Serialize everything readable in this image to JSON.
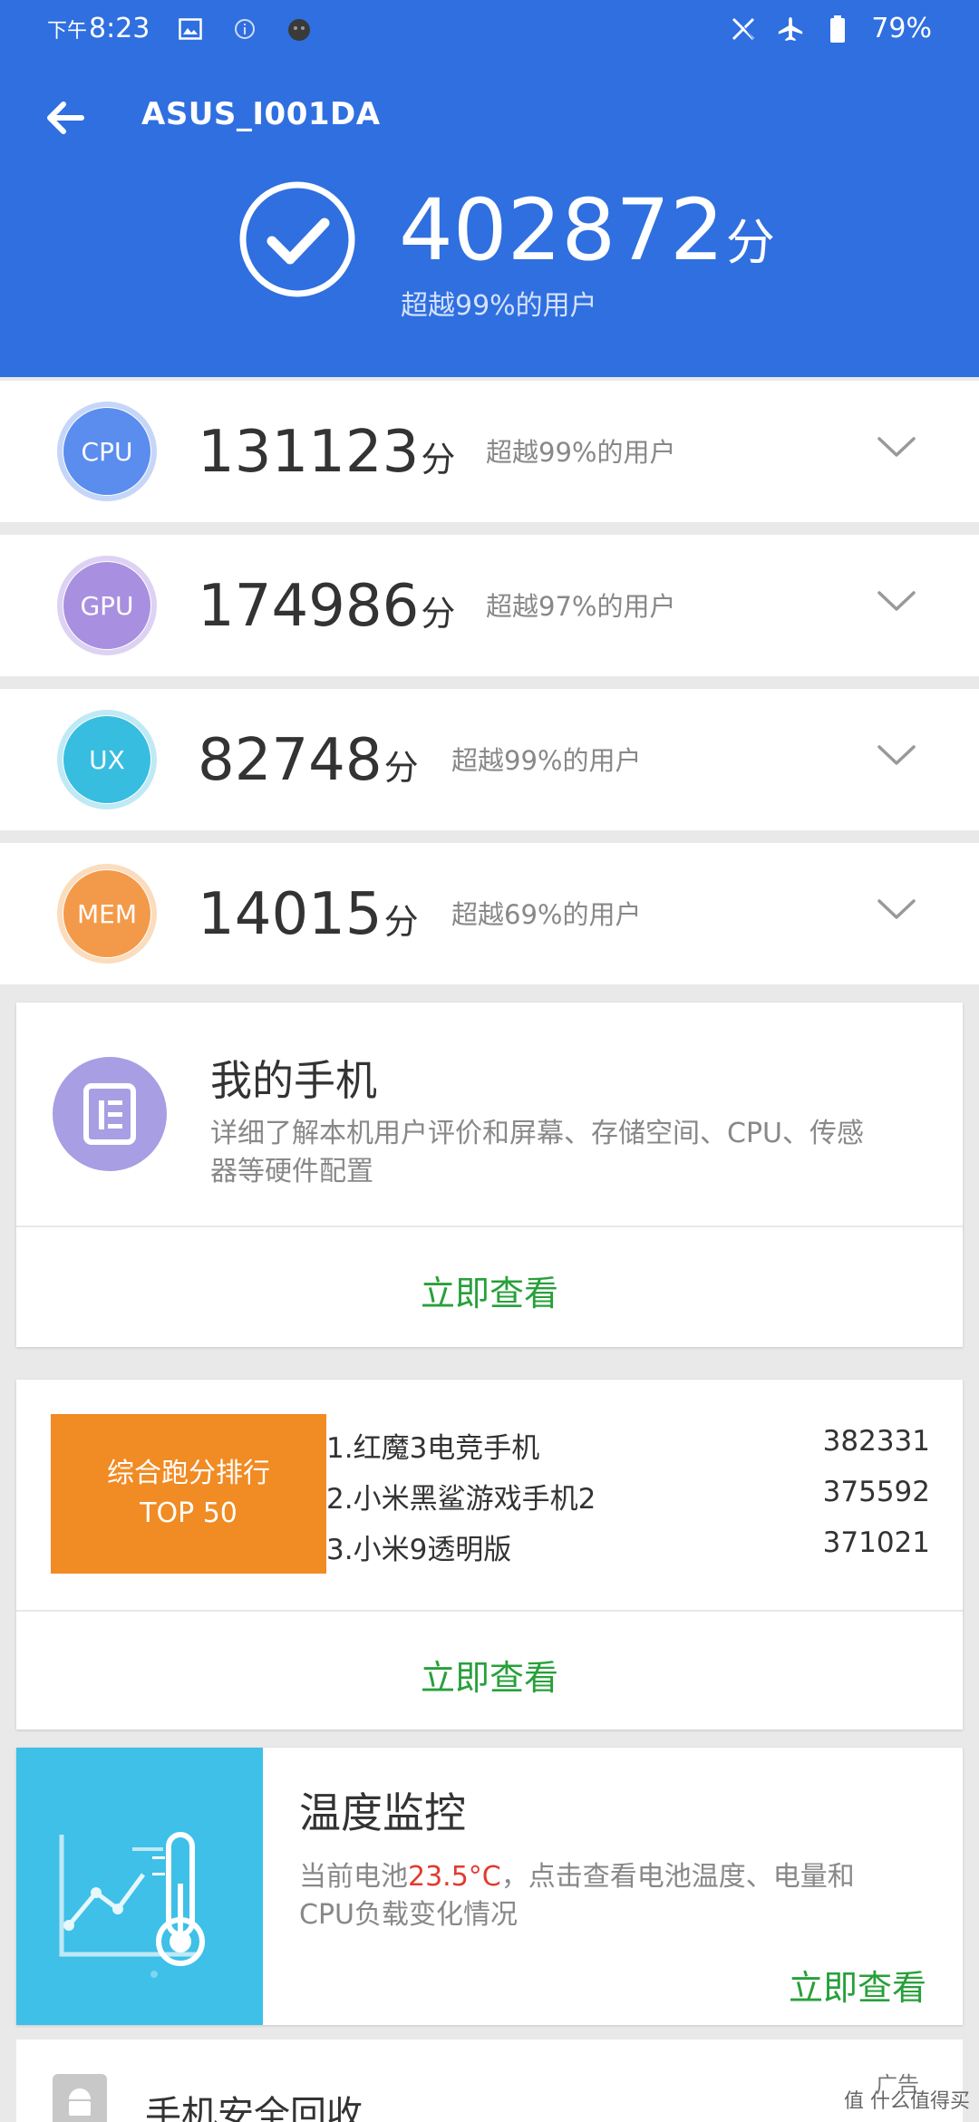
{
  "status_bar": {
    "ampm": "下午",
    "time": "8:23",
    "battery": "79%",
    "icons": [
      "gallery-icon",
      "info-icon",
      "app-icon",
      "x-icon",
      "airplane-icon",
      "battery-icon"
    ]
  },
  "header": {
    "title": "ASUS_I001DA",
    "total_score": "402872",
    "unit": "分",
    "total_sub": "超越99%的用户",
    "bg_color": "#2f6fe0"
  },
  "scores": [
    {
      "label": "CPU",
      "score": "131123",
      "unit": "分",
      "sub": "超越99%的用户",
      "color": "#5b8def"
    },
    {
      "label": "GPU",
      "score": "174986",
      "unit": "分",
      "sub": "超越97%的用户",
      "color": "#a98fe0"
    },
    {
      "label": "UX",
      "score": "82748",
      "unit": "分",
      "sub": "超越99%的用户",
      "color": "#37bde0"
    },
    {
      "label": "MEM",
      "score": "14015",
      "unit": "分",
      "sub": "超越69%的用户",
      "color": "#f39a4a"
    }
  ],
  "my_phone": {
    "title": "我的手机",
    "desc_line1": "详细了解本机用户评价和屏幕、存储空间、CPU、传感",
    "desc_line2": "器等硬件配置",
    "action": "立即查看"
  },
  "ranking": {
    "banner_line1": "综合跑分排行",
    "banner_line2": "TOP 50",
    "items": [
      {
        "name": "1.红魔3电竞手机",
        "score": "382331"
      },
      {
        "name": "2.小米黑鲨游戏手机2",
        "score": "375592"
      },
      {
        "name": "3.小米9透明版",
        "score": "371021"
      }
    ],
    "action": "立即查看"
  },
  "temperature": {
    "title": "温度监控",
    "desc_prefix": "当前电池",
    "temp": "23.5°C",
    "desc_suffix": "，点击查看电池温度、电量和",
    "desc_line2": "CPU负载变化情况",
    "action": "立即查看"
  },
  "ad": {
    "title": "手机安全回收",
    "label": "广告"
  },
  "watermark": "值 什么值得买"
}
